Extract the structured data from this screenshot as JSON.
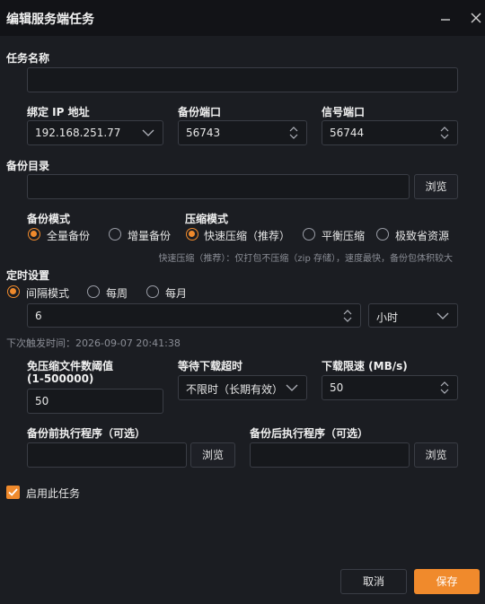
{
  "window": {
    "title": "编辑服务端任务"
  },
  "task_name": {
    "label": "任务名称",
    "value": ""
  },
  "bind_ip": {
    "label": "绑定 IP 地址",
    "value": "192.168.251.77"
  },
  "backup_port": {
    "label": "备份端口",
    "value": "56743"
  },
  "signal_port": {
    "label": "信号端口",
    "value": "56744"
  },
  "backup_dir": {
    "label": "备份目录",
    "value": "",
    "browse": "浏览"
  },
  "backup_mode": {
    "label": "备份模式",
    "options": [
      "全量备份",
      "增量备份"
    ],
    "selected": "全量备份"
  },
  "compress_mode": {
    "label": "压缩模式",
    "options": [
      "快速压缩（推荐）",
      "平衡压缩",
      "极致省资源"
    ],
    "selected": "快速压缩（推荐）",
    "hint": "快速压缩（推荐）：仅打包不压缩（zip 存储），速度最快，备份包体积较大"
  },
  "schedule": {
    "label": "定时设置",
    "options": [
      "间隔模式",
      "每周",
      "每月"
    ],
    "selected": "间隔模式",
    "interval_value": "6",
    "interval_unit": "小时",
    "next_trigger": "下次触发时间：2026-09-07 20:41:38"
  },
  "no_compress_threshold": {
    "label_line1": "免压缩文件数阈值",
    "label_line2": "(1-500000)",
    "value": "50"
  },
  "download_timeout": {
    "label": "等待下载超时",
    "value": "不限时（长期有效）"
  },
  "download_limit": {
    "label": "下载限速 (MB/s)",
    "value": "50"
  },
  "pre_program": {
    "label": "备份前执行程序（可选）",
    "value": "",
    "browse": "浏览"
  },
  "post_program": {
    "label": "备份后执行程序（可选）",
    "value": "",
    "browse": "浏览"
  },
  "enable_task": {
    "label": "启用此任务",
    "checked": true
  },
  "footer": {
    "cancel": "取消",
    "save": "保存"
  },
  "colors": {
    "accent": "#f08a2c",
    "background": "#1b1d22",
    "titlebar": "#121317",
    "field": "#16181c",
    "border": "#3a3d45"
  }
}
